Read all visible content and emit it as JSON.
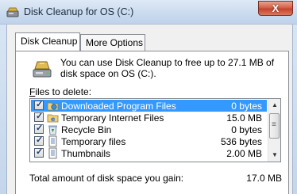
{
  "window": {
    "title": "Disk Cleanup for OS (C:)",
    "close_glyph": "X"
  },
  "tabs": [
    {
      "label": "Disk Cleanup"
    },
    {
      "label": "More Options"
    }
  ],
  "intro": {
    "text": "You can use Disk Cleanup to free up to 27.1 MB of disk space on OS (C:)."
  },
  "files": {
    "label_accel": "F",
    "label_rest": "iles to delete:",
    "items": [
      {
        "name": "Downloaded Program Files",
        "size": "0 bytes",
        "checked": true,
        "selected": true,
        "icon": "folder-globe-icon"
      },
      {
        "name": "Temporary Internet Files",
        "size": "15.0 MB",
        "checked": true,
        "selected": false,
        "icon": "ie-folder-icon"
      },
      {
        "name": "Recycle Bin",
        "size": "0 bytes",
        "checked": true,
        "selected": false,
        "icon": "recycle-bin-icon"
      },
      {
        "name": "Temporary files",
        "size": "536 bytes",
        "checked": true,
        "selected": false,
        "icon": "document-icon"
      },
      {
        "name": "Thumbnails",
        "size": "2.00 MB",
        "checked": true,
        "selected": false,
        "icon": "document-icon"
      }
    ]
  },
  "total": {
    "label": "Total amount of disk space you gain:",
    "value": "17.0 MB"
  },
  "colors": {
    "selection": "#3399ff",
    "close_button": "#c4452e"
  }
}
